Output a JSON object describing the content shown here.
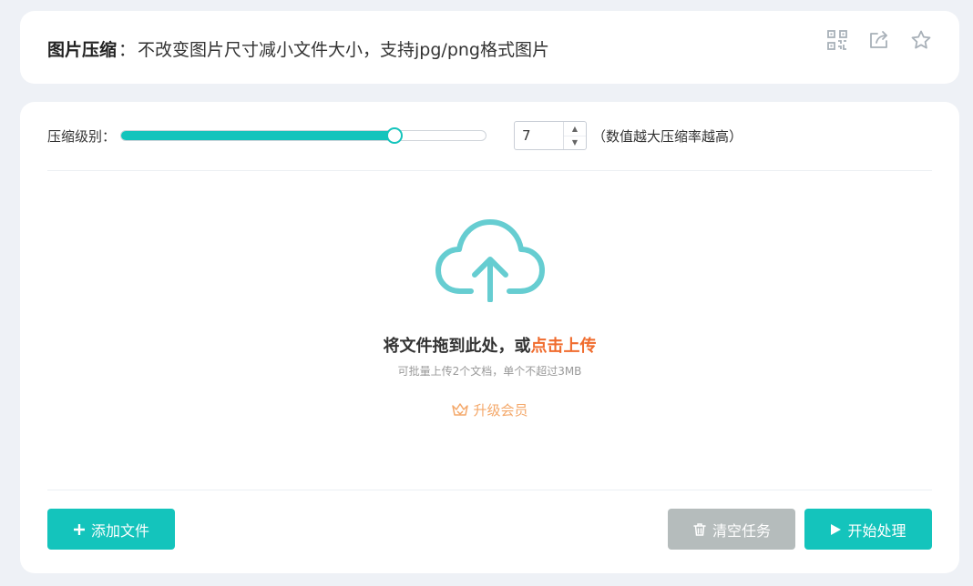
{
  "header": {
    "title_strong": "图片压缩",
    "separator": "：",
    "title_desc": "不改变图片尺寸减小文件大小，支持jpg/png格式图片",
    "icons": [
      "qrcode-icon",
      "share-icon",
      "star-icon"
    ]
  },
  "settings": {
    "level_label": "压缩级别：",
    "level_value": "7",
    "level_fraction": 0.75,
    "hint": "（数值越大压缩率越高）"
  },
  "drop": {
    "title_prefix": "将文件拖到此处，或",
    "upload_link": "点击上传",
    "subtitle": "可批量上传2个文档，单个不超过3MB",
    "vip_label": "升级会员"
  },
  "buttons": {
    "add": "添加文件",
    "clear": "清空任务",
    "start": "开始处理"
  },
  "colors": {
    "accent": "#14c4bc",
    "link": "#f06c2e",
    "vip": "#f4a86a",
    "cloud": "#66cdd1",
    "disabled": "#b5bcbc"
  }
}
